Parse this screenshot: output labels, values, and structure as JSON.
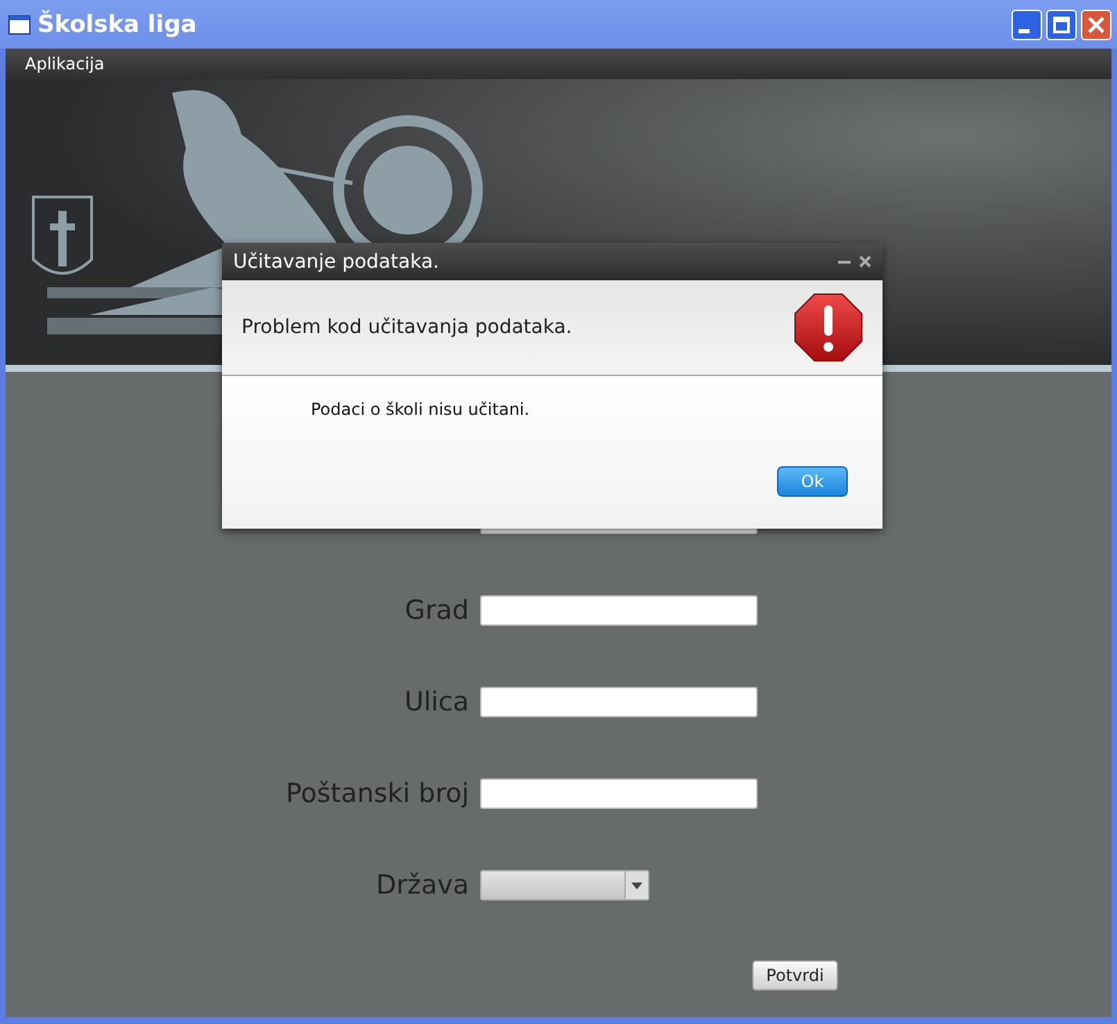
{
  "window": {
    "title": "Školska liga"
  },
  "menu": [
    "Aplikacija"
  ],
  "form": {
    "fields": [
      {
        "label": "Grad",
        "kind": "text"
      },
      {
        "label": "Ulica",
        "kind": "text"
      },
      {
        "label": "Poštanski broj",
        "kind": "text"
      },
      {
        "label": "Država",
        "kind": "select"
      }
    ],
    "submit": "Potvrdi"
  },
  "dialog": {
    "title": "Učitavanje podataka.",
    "header": "Problem kod učitavanja podataka.",
    "message": "Podaci o školi nisu učitani.",
    "button": "Ok"
  }
}
